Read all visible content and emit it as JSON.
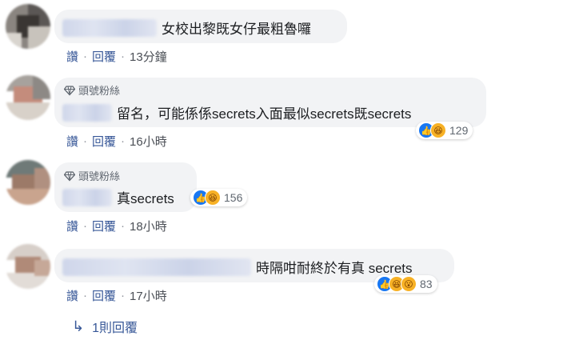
{
  "comments": [
    {
      "text": "女校出黎既女仔最粗魯囉",
      "actions": {
        "like": "讚",
        "reply": "回覆",
        "time": "13分鐘"
      }
    },
    {
      "badge": "頭號粉絲",
      "text": "留名，可能係係secrets入面最似secrets既secrets",
      "reactions": {
        "count": "129",
        "types": [
          "like-icon",
          "haha-icon"
        ]
      },
      "actions": {
        "like": "讚",
        "reply": "回覆",
        "time": "16小時"
      }
    },
    {
      "badge": "頭號粉絲",
      "text": "真secrets",
      "reactions": {
        "count": "156",
        "types": [
          "like-icon",
          "haha-icon"
        ]
      },
      "actions": {
        "like": "讚",
        "reply": "回覆",
        "time": "18小時"
      }
    },
    {
      "text": "時隔咁耐終於有真 secrets",
      "reactions": {
        "count": "83",
        "types": [
          "like-icon",
          "haha-icon",
          "wow-icon"
        ]
      },
      "actions": {
        "like": "讚",
        "reply": "回覆",
        "time": "17小時"
      }
    }
  ],
  "replies_link": {
    "arrow": "↳",
    "label": "1則回覆"
  },
  "colors": {
    "bubble": "#f2f3f5",
    "link": "#385898",
    "like": "#1877f2",
    "emoji": "#f7b125"
  }
}
